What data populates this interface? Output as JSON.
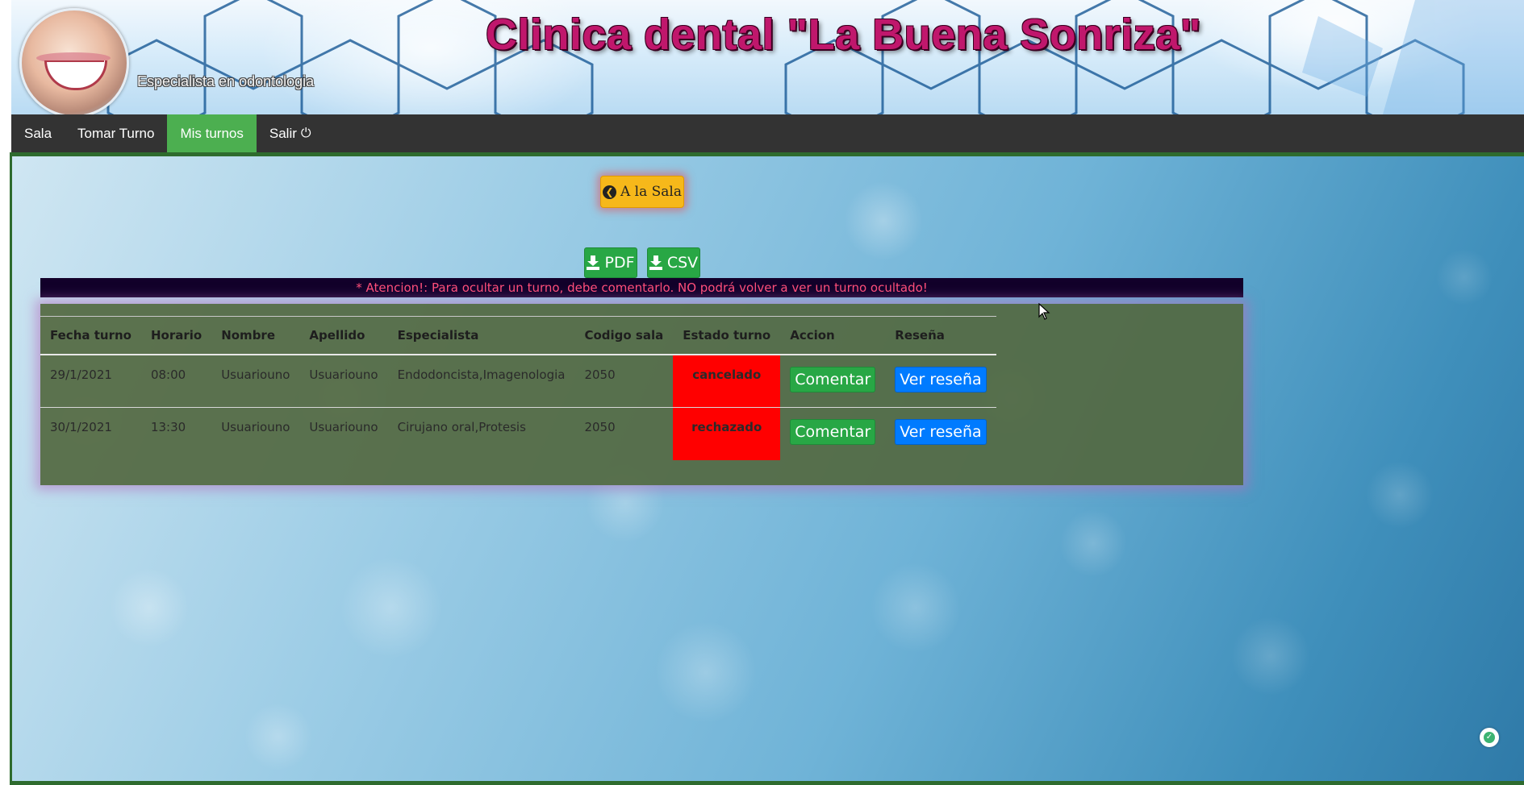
{
  "header": {
    "title": "Clinica dental \"La Buena Sonriza\"",
    "subtitle": "Especialista en odontologia",
    "logo_icon": "smile-logo-icon"
  },
  "navbar": {
    "items": [
      {
        "label": "Sala",
        "active": false
      },
      {
        "label": "Tomar Turno",
        "active": false
      },
      {
        "label": "Mis turnos",
        "active": true
      },
      {
        "label": "Salir",
        "active": false,
        "icon": "power-icon",
        "icon_glyph": "⏻"
      }
    ],
    "active_color": "#4caf50"
  },
  "actions": {
    "back_label": "A la Sala",
    "back_icon": "circle-arrow-left-icon",
    "pdf_label": "PDF",
    "csv_label": "CSV",
    "download_icon": "download-icon"
  },
  "warning": "* Atencion!: Para ocultar un turno, debe comentarlo. NO podrá volver a ver un turno ocultado!",
  "table": {
    "columns": [
      "Fecha turno",
      "Horario",
      "Nombre",
      "Apellido",
      "Especialista",
      "Codigo sala",
      "Estado turno",
      "Accion",
      "Reseña"
    ],
    "rows": [
      {
        "fecha": "29/1/2021",
        "horario": "08:00",
        "nombre": "Usuariouno",
        "apellido": "Usuariouno",
        "especialista": "Endodoncista,Imagenologia",
        "sala": "2050",
        "estado": "cancelado",
        "accion": "Comentar",
        "resena": "Ver reseña"
      },
      {
        "fecha": "30/1/2021",
        "horario": "13:30",
        "nombre": "Usuariouno",
        "apellido": "Usuariouno",
        "especialista": "Cirujano oral,Protesis",
        "sala": "2050",
        "estado": "rechazado",
        "accion": "Comentar",
        "resena": "Ver reseña"
      }
    ],
    "estado_color": "#ff0000"
  },
  "colors": {
    "title": "#c0176c",
    "navbar": "#333333",
    "success": "#28a745",
    "primary": "#007bff",
    "warning_button": "#f6b81a",
    "warning_text": "#ff4f7a"
  }
}
